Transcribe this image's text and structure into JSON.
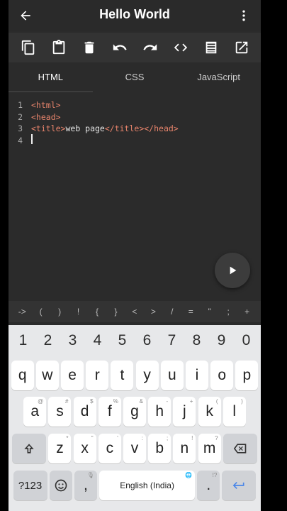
{
  "app": {
    "title": "Hello World"
  },
  "toolbar": {
    "icons": [
      "copy-icon",
      "paste-icon",
      "delete-icon",
      "undo-icon",
      "redo-icon",
      "code-icon",
      "format-icon",
      "open-external-icon"
    ]
  },
  "tabs": [
    {
      "label": "HTML",
      "active": true
    },
    {
      "label": "CSS",
      "active": false
    },
    {
      "label": "JavaScript",
      "active": false
    }
  ],
  "editor": {
    "lines": [
      {
        "num": "1",
        "parts": [
          {
            "t": "<html>",
            "tag": true
          }
        ]
      },
      {
        "num": "2",
        "parts": [
          {
            "t": "<head>",
            "tag": true
          }
        ]
      },
      {
        "num": "3",
        "parts": [
          {
            "t": "<title>",
            "tag": true
          },
          {
            "t": "web page",
            "tag": false
          },
          {
            "t": "</title></head>",
            "tag": true
          }
        ]
      },
      {
        "num": "4",
        "parts": []
      }
    ]
  },
  "symbols": [
    "->",
    "(",
    ")",
    "!",
    "{",
    "}",
    "<",
    ">",
    "/",
    "=",
    "\"",
    ";",
    "+"
  ],
  "keyboard": {
    "numbers": [
      "1",
      "2",
      "3",
      "4",
      "5",
      "6",
      "7",
      "8",
      "9",
      "0"
    ],
    "row1": [
      {
        "k": "q",
        "a": ""
      },
      {
        "k": "w",
        "a": ""
      },
      {
        "k": "e",
        "a": ""
      },
      {
        "k": "r",
        "a": ""
      },
      {
        "k": "t",
        "a": ""
      },
      {
        "k": "y",
        "a": ""
      },
      {
        "k": "u",
        "a": ""
      },
      {
        "k": "i",
        "a": ""
      },
      {
        "k": "o",
        "a": ""
      },
      {
        "k": "p",
        "a": ""
      }
    ],
    "row2": [
      {
        "k": "a",
        "a": "@"
      },
      {
        "k": "s",
        "a": "#"
      },
      {
        "k": "d",
        "a": "$"
      },
      {
        "k": "f",
        "a": "%"
      },
      {
        "k": "g",
        "a": "&"
      },
      {
        "k": "h",
        "a": "-"
      },
      {
        "k": "j",
        "a": "+"
      },
      {
        "k": "k",
        "a": "("
      },
      {
        "k": "l",
        "a": ")"
      }
    ],
    "row3": [
      {
        "k": "z",
        "a": "*"
      },
      {
        "k": "x",
        "a": "\""
      },
      {
        "k": "c",
        "a": "'"
      },
      {
        "k": "v",
        "a": ":"
      },
      {
        "k": "b",
        "a": ";"
      },
      {
        "k": "n",
        "a": "!"
      },
      {
        "k": "m",
        "a": "?"
      }
    ],
    "sym_label": "?123",
    "comma": ",",
    "space_label": "English (India)",
    "period": ".",
    "period_alt": "!?"
  },
  "colors": {
    "tag": "#e8846c",
    "background": "#2b2b2b",
    "keyboard": "#e7e8ea",
    "enter": "#4a86e8"
  }
}
